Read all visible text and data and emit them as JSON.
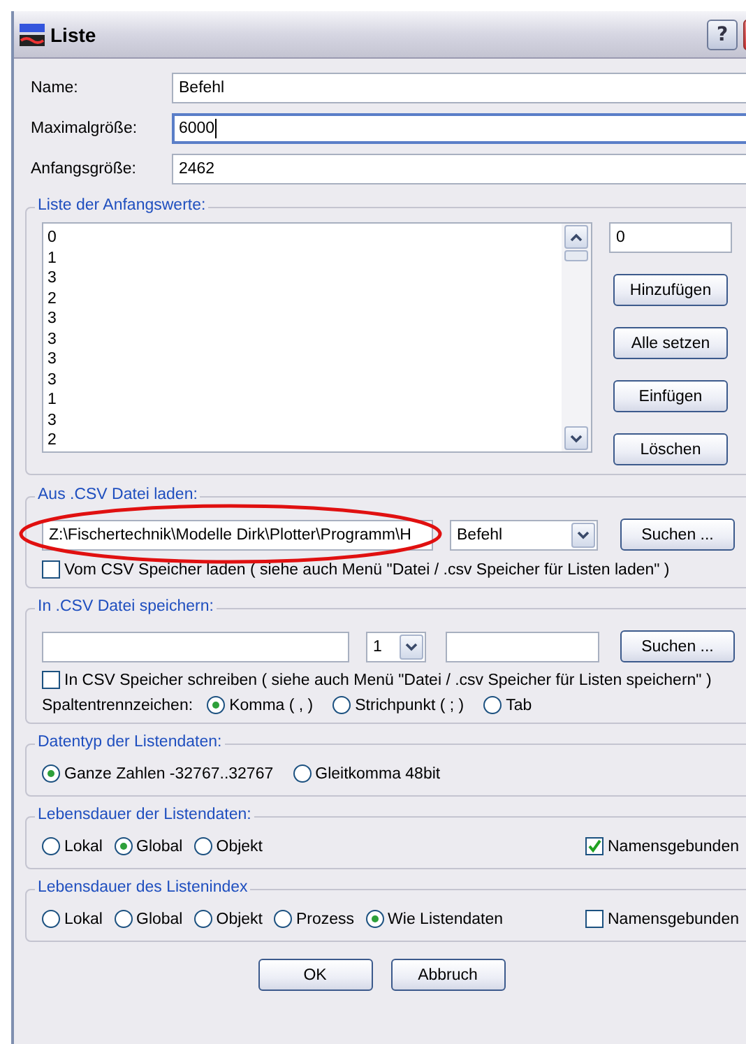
{
  "window": {
    "title": "Liste",
    "help_label": "?"
  },
  "fields": [
    {
      "label": "Name:",
      "value": "Befehl",
      "focused": false
    },
    {
      "label": "Maximalgröße:",
      "value": "6000",
      "focused": true
    },
    {
      "label": "Anfangsgröße:",
      "value": "2462",
      "focused": false
    }
  ],
  "initial_values": {
    "title": "Liste der Anfangswerte:",
    "items": [
      "0",
      "1",
      "3",
      "2",
      "3",
      "3",
      "3",
      "3",
      "1",
      "3",
      "2"
    ],
    "value_field": "0",
    "buttons": [
      "Hinzufügen",
      "Alle setzen",
      "Einfügen",
      "Löschen"
    ]
  },
  "load_csv": {
    "title": "Aus .CSV Datei laden:",
    "path": "Z:\\Fischertechnik\\Modelle Dirk\\Plotter\\Programm\\H",
    "path_highlighted": true,
    "combo": "Befehl",
    "button": "Suchen ...",
    "checkbox": {
      "label": "Vom CSV Speicher laden ( siehe auch Menü \"Datei / .csv Speicher für Listen laden\" )",
      "checked": false
    }
  },
  "save_csv": {
    "title": "In .CSV Datei speichern:",
    "combo": "1",
    "button": "Suchen ...",
    "checkbox": {
      "label": "In CSV Speicher schreiben ( siehe auch Menü \"Datei / .csv Speicher für Listen speichern\" )",
      "checked": false
    },
    "separator_label": "Spaltentrennzeichen:",
    "separator_options": [
      {
        "label": "Komma ( , )",
        "selected": true
      },
      {
        "label": "Strichpunkt ( ; )",
        "selected": false
      },
      {
        "label": "Tab",
        "selected": false
      }
    ]
  },
  "data_type": {
    "title": "Datentyp der Listendaten:",
    "options": [
      {
        "label": "Ganze Zahlen -32767..32767",
        "selected": true
      },
      {
        "label": "Gleitkomma 48bit",
        "selected": false
      }
    ]
  },
  "data_lifetime": {
    "title": "Lebensdauer der Listendaten:",
    "options": [
      {
        "label": "Lokal",
        "selected": false
      },
      {
        "label": "Global",
        "selected": true
      },
      {
        "label": "Objekt",
        "selected": false
      }
    ],
    "checkbox": {
      "label": "Namensgebunden",
      "checked": true
    }
  },
  "index_lifetime": {
    "title": "Lebensdauer des Listenindex",
    "options": [
      {
        "label": "Lokal",
        "selected": false
      },
      {
        "label": "Global",
        "selected": false
      },
      {
        "label": "Objekt",
        "selected": false
      },
      {
        "label": "Prozess",
        "selected": false
      },
      {
        "label": "Wie Listendaten",
        "selected": true
      }
    ],
    "checkbox": {
      "label": "Namensgebunden",
      "checked": false
    }
  },
  "buttons": [
    "OK",
    "Abbruch"
  ]
}
